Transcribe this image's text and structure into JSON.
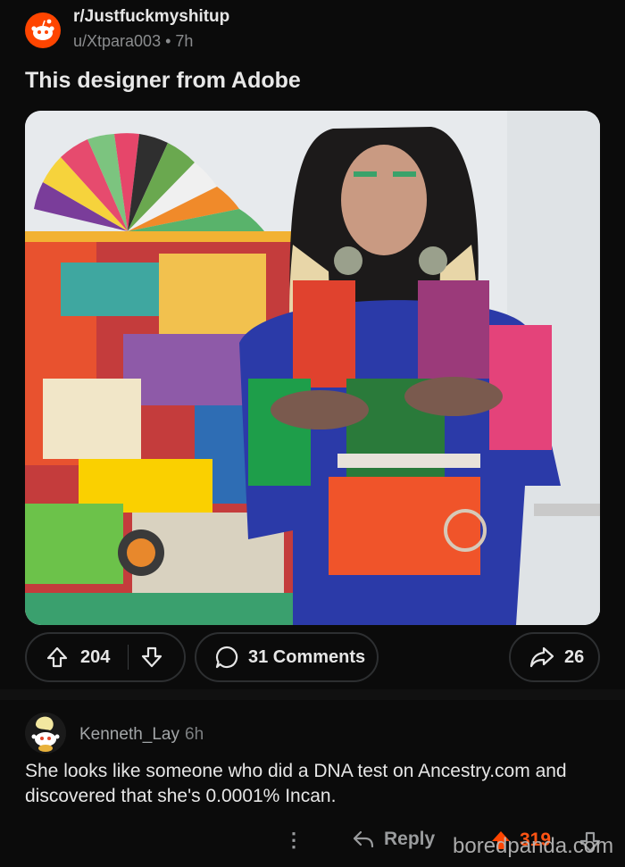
{
  "post": {
    "subreddit": "r/Justfuckmyshitup",
    "author": "u/Xtpara003",
    "separator": "•",
    "age": "7h",
    "title": "This designer from Adobe"
  },
  "actions": {
    "upvotes": "204",
    "comments_label": "31 Comments",
    "shares": "26"
  },
  "comment": {
    "username": "Kenneth_Lay",
    "age": "6h",
    "body": "She looks like someone who did a DNA test on Ancestry.com and discovered that she's 0.0001% Incan.",
    "more_label": "⋮",
    "reply_label": "Reply",
    "score": "319"
  },
  "watermark": "boredpanda.com",
  "colors": {
    "background": "#0b0b0b",
    "reddit_orange": "#ff4500",
    "upvoted_orange": "#ff5414",
    "text_primary": "#e6e6e6",
    "text_muted": "#8a8c8e"
  }
}
